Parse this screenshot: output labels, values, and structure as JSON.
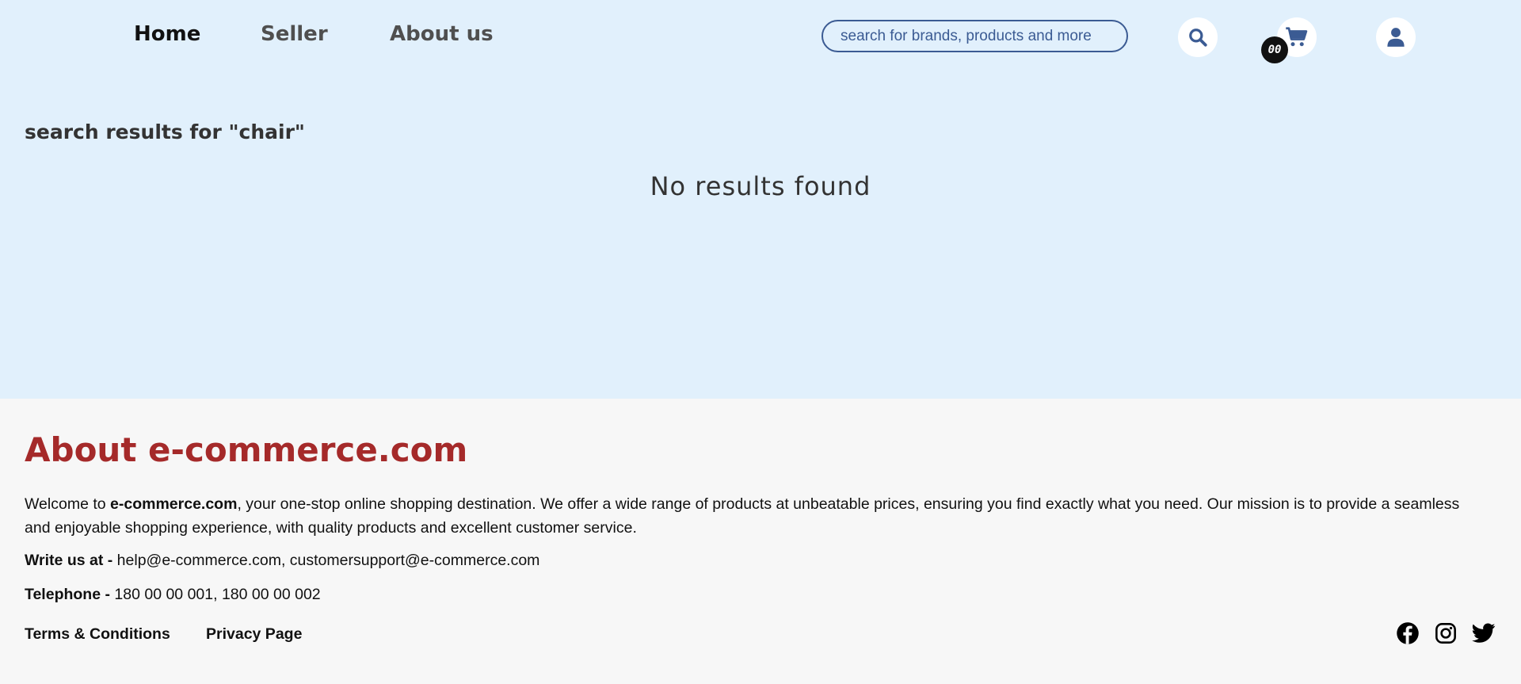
{
  "nav": {
    "home": "Home",
    "seller": "Seller",
    "about": "About us"
  },
  "search": {
    "placeholder": "search for brands, products and more"
  },
  "cart": {
    "count": "00"
  },
  "results": {
    "title": "search results for \"chair\"",
    "empty_message": "No results found"
  },
  "footer": {
    "about_title": "About e-commerce.com",
    "about_intro": "Welcome to ",
    "about_brand": "e-commerce.com",
    "about_rest": ", your one-stop online shopping destination. We offer a wide range of products at unbeatable prices, ensuring you find exactly what you need. Our mission is to provide a seamless and enjoyable shopping experience, with quality products and excellent customer service.",
    "write_label": "Write us at - ",
    "write_value": "help@e-commerce.com, customersupport@e-commerce.com",
    "phone_label": "Telephone - ",
    "phone_value": "180 00 00 001, 180 00 00 002",
    "terms": "Terms & Conditions",
    "privacy": "Privacy Page"
  },
  "icons": {
    "search": "search-icon",
    "cart": "cart-icon",
    "user": "user-icon",
    "facebook": "facebook-icon",
    "instagram": "instagram-icon",
    "twitter": "twitter-icon"
  },
  "colors": {
    "header_bg": "#e1f0fc",
    "footer_bg": "#f7f7f7",
    "accent": "#3b5b93",
    "about_title": "#a52a2a"
  }
}
